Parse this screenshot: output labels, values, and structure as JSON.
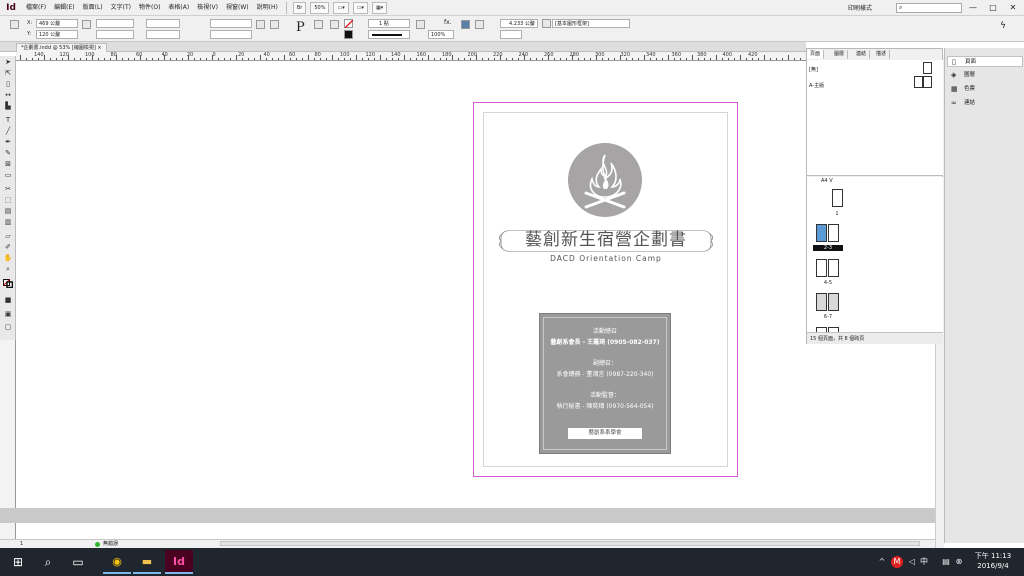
{
  "menubar": {
    "app_letters": "Id",
    "items": [
      "檔案(F)",
      "編輯(E)",
      "版面(L)",
      "文字(T)",
      "物件(O)",
      "表格(A)",
      "檢視(V)",
      "視窗(W)",
      "說明(H)"
    ],
    "zoom": "50%",
    "workspace": "印刷樣式",
    "search_placeholder": "",
    "window_controls": [
      "—",
      "□",
      "✕"
    ]
  },
  "controlbar": {
    "x_label": "X:",
    "x_value": "469 公釐",
    "y_label": "Y:",
    "y_value": "120 公釐",
    "stroke_weight": "1 點",
    "opacity": "100%",
    "measure": "4.233 公釐",
    "style_value": "[基本圖形框架]"
  },
  "tabs": {
    "document": "*企劃書.indd @ 53% [縮圖檢視]",
    "close": "×"
  },
  "ruler_labels": [
    "140",
    "120",
    "100",
    "80",
    "60",
    "40",
    "20",
    "0",
    "20",
    "40",
    "60",
    "80",
    "100",
    "120",
    "140",
    "160",
    "180",
    "200",
    "220",
    "240",
    "260",
    "280",
    "300",
    "320",
    "340",
    "360",
    "380",
    "400",
    "420"
  ],
  "document": {
    "title": "藝創新生宿營企劃書",
    "subtitle": "DACD Orientation Camp",
    "info": {
      "lines": [
        "活動總召",
        "藝創系會長 - 王羅琦 (0905-082-037)",
        "副總召：",
        "系會總務 - 董鴻言 (0987-220-340)",
        "活動監督：",
        "執行秘書 - 陳奕璋 (0970-564-054)"
      ],
      "button": "藝創系系學會"
    }
  },
  "status": {
    "page": "1",
    "state": "無錯誤"
  },
  "pages_panel": {
    "tabs": [
      "頁面",
      "圖層",
      "連結",
      "描述"
    ],
    "none_label": "[無]",
    "master_label": "A-主版",
    "spread_labels": [
      "1",
      "2-3",
      "4-5",
      "6-7",
      "8-9"
    ],
    "master_dropdown": "A4 V",
    "footer": "15 個頁面，共 8 個跨頁"
  },
  "right_dock": {
    "items": [
      "頁面",
      "圖層",
      "色票",
      "連結"
    ]
  },
  "taskbar": {
    "time": "下午 11:13",
    "date": "2016/9/4",
    "ime": "中"
  },
  "colors": {
    "bleed": "#d35ad3",
    "accent": "#49021f",
    "taskbar": "#20262d"
  }
}
